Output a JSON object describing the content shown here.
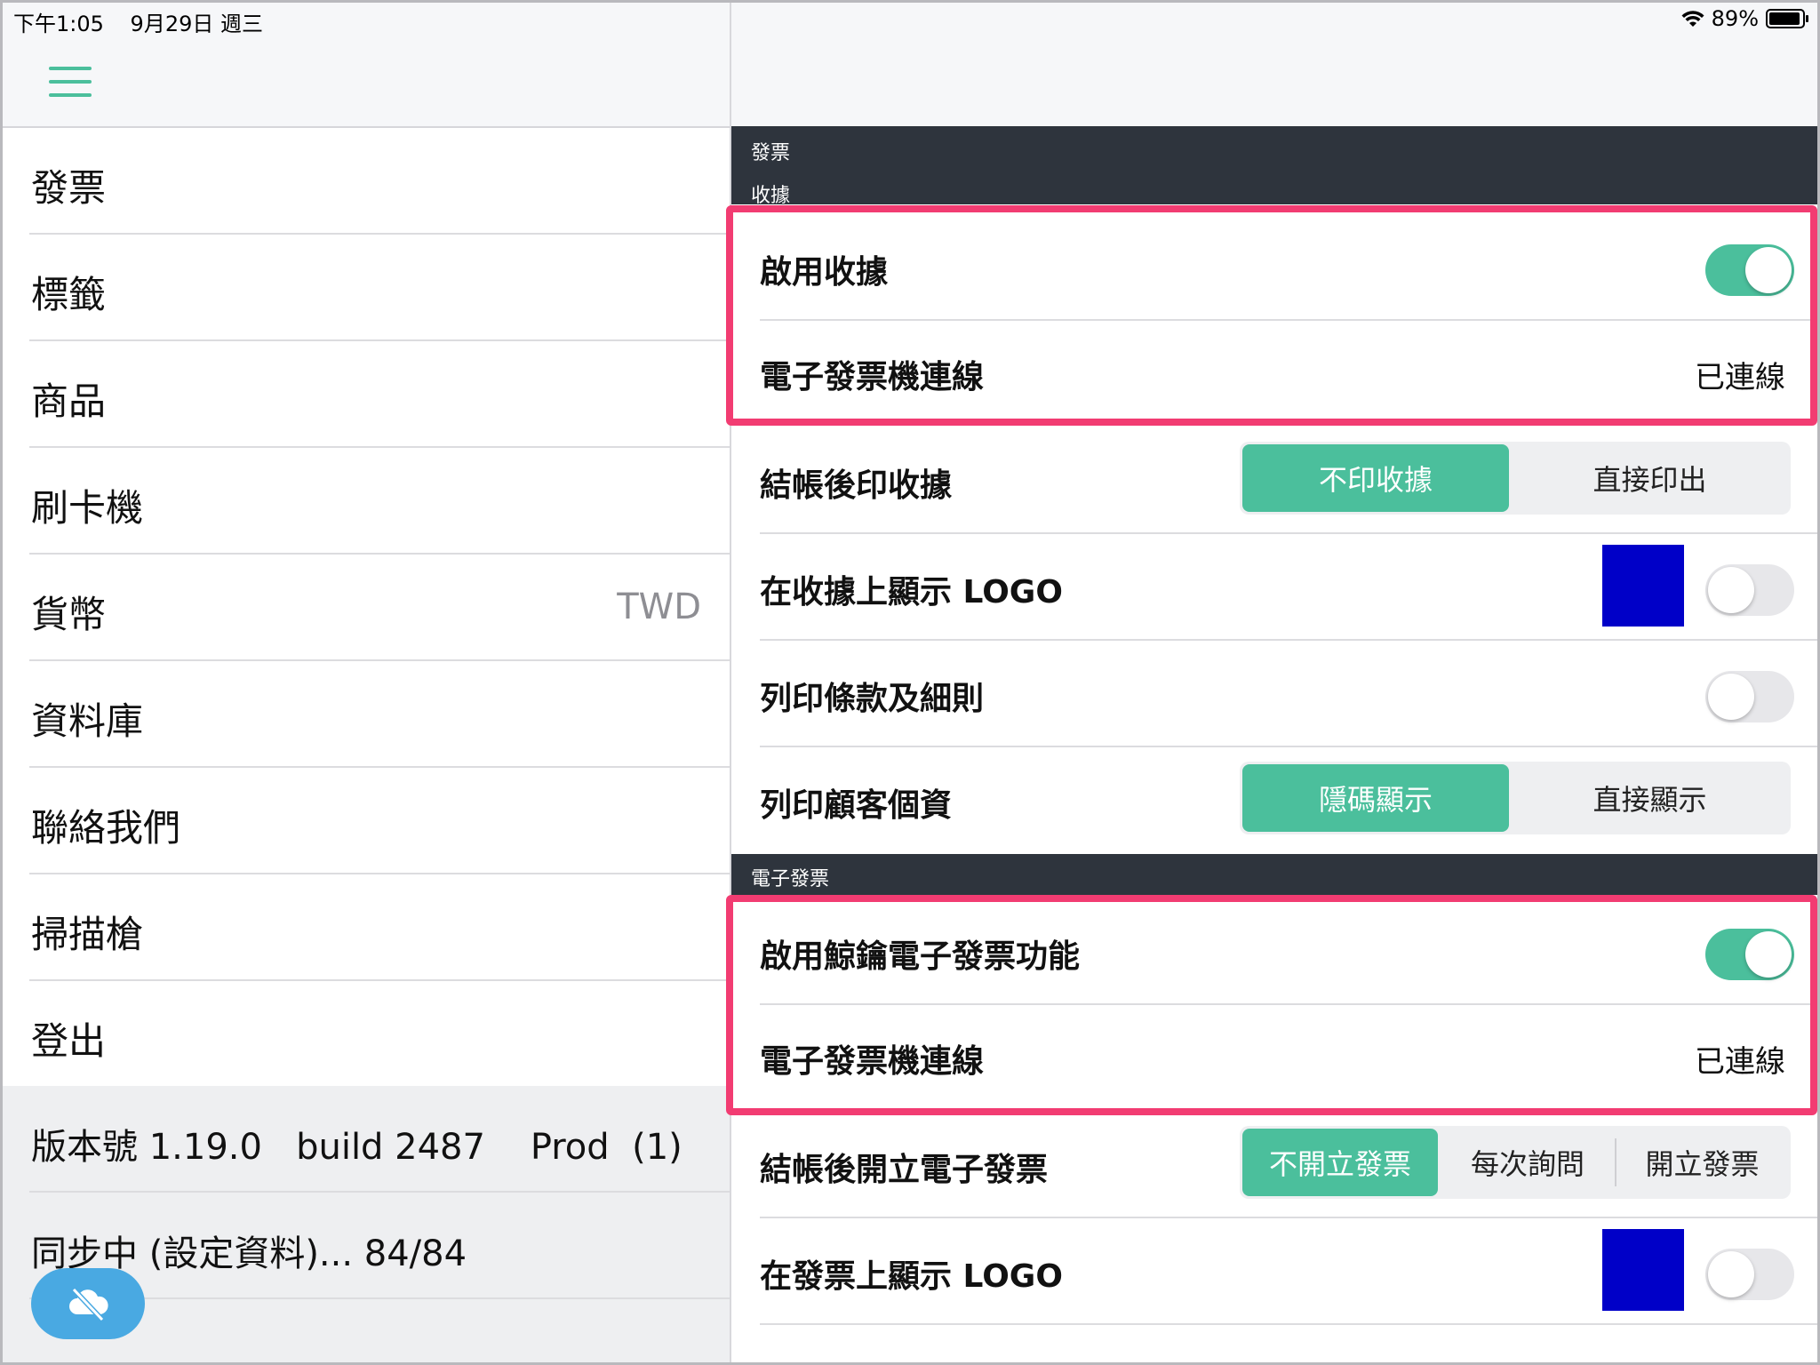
{
  "status_bar": {
    "time": "下午1:05",
    "date": "9月29日 週三",
    "battery": "89%"
  },
  "sidebar": {
    "items": [
      {
        "label": "發票"
      },
      {
        "label": "標籤"
      },
      {
        "label": "商品"
      },
      {
        "label": "刷卡機"
      },
      {
        "label": "貨幣",
        "value": "TWD"
      },
      {
        "label": "資料庫"
      },
      {
        "label": "聯絡我們"
      },
      {
        "label": "掃描槍"
      },
      {
        "label": "登出"
      }
    ],
    "version": "版本號 1.19.0   build 2487    Prod  (1)",
    "sync_status": "同步中 (設定資料)... 84/84"
  },
  "main": {
    "breadcrumb": "發票",
    "receipt_section": {
      "title": "收據",
      "enable_receipt": {
        "label": "啟用收據",
        "on": true
      },
      "einvoice_connection": {
        "label": "電子發票機連線",
        "value": "已連線"
      },
      "print_after_checkout": {
        "label": "結帳後印收據",
        "options": [
          "不印收據",
          "直接印出"
        ],
        "selected": 0
      },
      "show_logo": {
        "label": "在收據上顯示 LOGO",
        "logo_color": "#0000c8",
        "on": false
      },
      "print_terms": {
        "label": "列印條款及細則",
        "on": false
      },
      "print_customer_info": {
        "label": "列印顧客個資",
        "options": [
          "隱碼顯示",
          "直接顯示"
        ],
        "selected": 0
      }
    },
    "einvoice_section": {
      "title": "電子發票",
      "enable_einvoice": {
        "label": "啟用鯨鑰電子發票功能",
        "on": true
      },
      "einvoice_connection": {
        "label": "電子發票機連線",
        "value": "已連線"
      },
      "issue_after_checkout": {
        "label": "結帳後開立電子發票",
        "options": [
          "不開立發票",
          "每次詢問",
          "開立發票"
        ],
        "selected": 0
      },
      "show_logo": {
        "label": "在發票上顯示 LOGO",
        "logo_color": "#0000c8",
        "on": false
      }
    }
  },
  "colors": {
    "accent": "#4bbf9c",
    "highlight": "#f23c72",
    "section_header": "#2e343d",
    "sync_button": "#49a9e2"
  }
}
